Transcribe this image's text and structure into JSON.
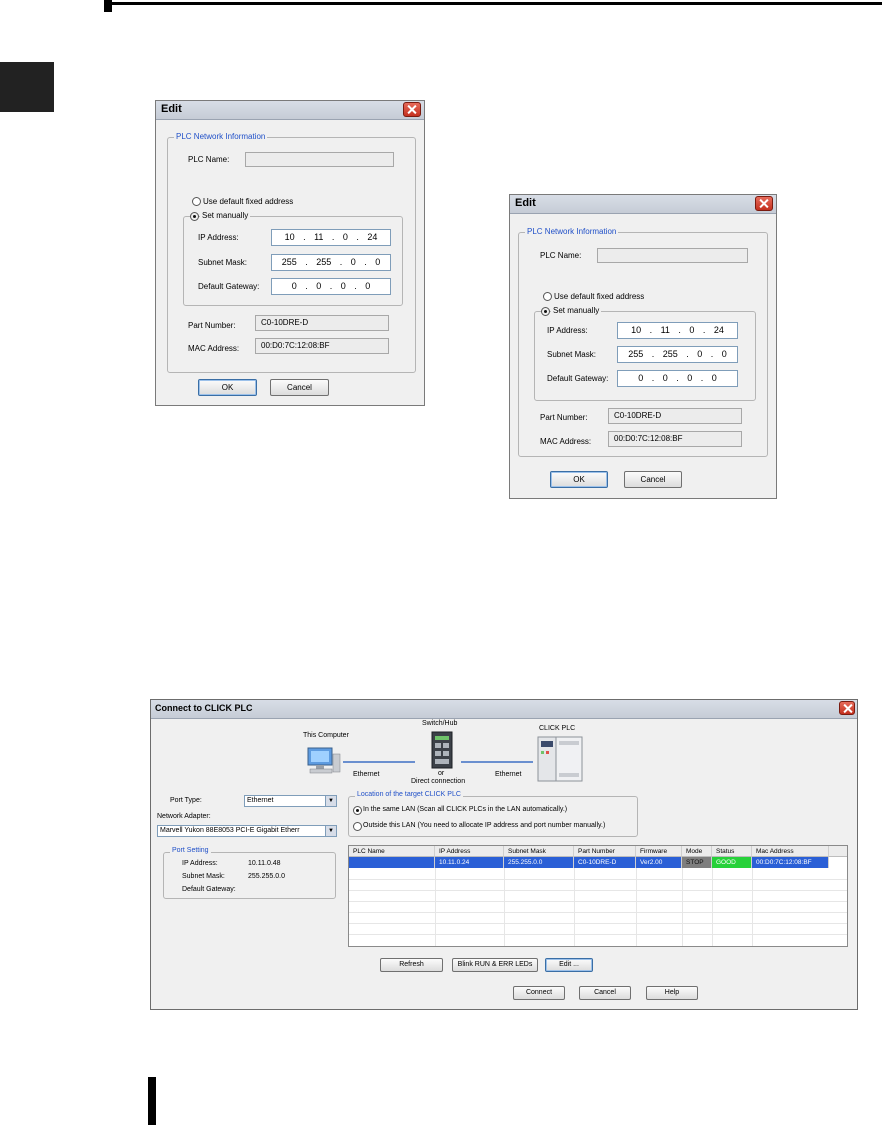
{
  "edit_dialog": {
    "title": "Edit",
    "group_title": "PLC Network Information",
    "plc_name_label": "PLC Name:",
    "plc_name_value": "",
    "radio_default_label": "Use default fixed address",
    "radio_manual_label": "Set manually",
    "ip_label": "IP Address:",
    "ip_value": "10 . 11 . 0 . 24",
    "subnet_label": "Subnet Mask:",
    "subnet_value": "255 . 255 . 0 . 0",
    "gateway_label": "Default Gateway:",
    "gateway_value": "0 . 0 . 0 . 0",
    "part_label": "Part Number:",
    "part_value": "C0-10DRE-D",
    "mac_label": "MAC Address:",
    "mac_value": "00:D0:7C:12:08:BF",
    "ok_label": "OK",
    "cancel_label": "Cancel"
  },
  "connect_dialog": {
    "title": "Connect to CLICK PLC",
    "diagram": {
      "computer_label": "This Computer",
      "switch_label": "Switch/Hub",
      "or_label": "or",
      "direct_label": "Direct connection",
      "plc_label": "CLICK PLC",
      "ethernet_left": "Ethernet",
      "ethernet_right": "Ethernet"
    },
    "port_type_label": "Port Type:",
    "port_type_value": "Ethernet",
    "network_adapter_label": "Network Adapter:",
    "network_adapter_value": "Marvell Yukon 88E8053 PCI-E Gigabit Etherr",
    "port_setting_title": "Port Setting",
    "port_ip_label": "IP Address:",
    "port_ip_value": "10.11.0.48",
    "port_subnet_label": "Subnet Mask:",
    "port_subnet_value": "255.255.0.0",
    "port_gateway_label": "Default Gateway:",
    "location_title": "Location of the target CLICK PLC",
    "location_same_lan": "In the same LAN (Scan all CLICK PLCs in the LAN automatically.)",
    "location_outside_lan": "Outside this LAN (You need to allocate IP address and port number manually.)",
    "table": {
      "headers": [
        "PLC Name",
        "IP Address",
        "Subnet Mask",
        "Part Number",
        "Firmware",
        "Mode",
        "Status",
        "Mac Address"
      ],
      "row": [
        "",
        "10.11.0.24",
        "255.255.0.0",
        "C0-10DRE-D",
        "Ver2.00",
        "STOP",
        "GOOD",
        "00:D0:7C:12:08:BF"
      ]
    },
    "refresh_label": "Refresh",
    "blink_label": "Blink RUN & ERR LEDs",
    "edit_label": "Edit ...",
    "connect_label": "Connect",
    "cancel_label": "Cancel",
    "help_label": "Help"
  }
}
